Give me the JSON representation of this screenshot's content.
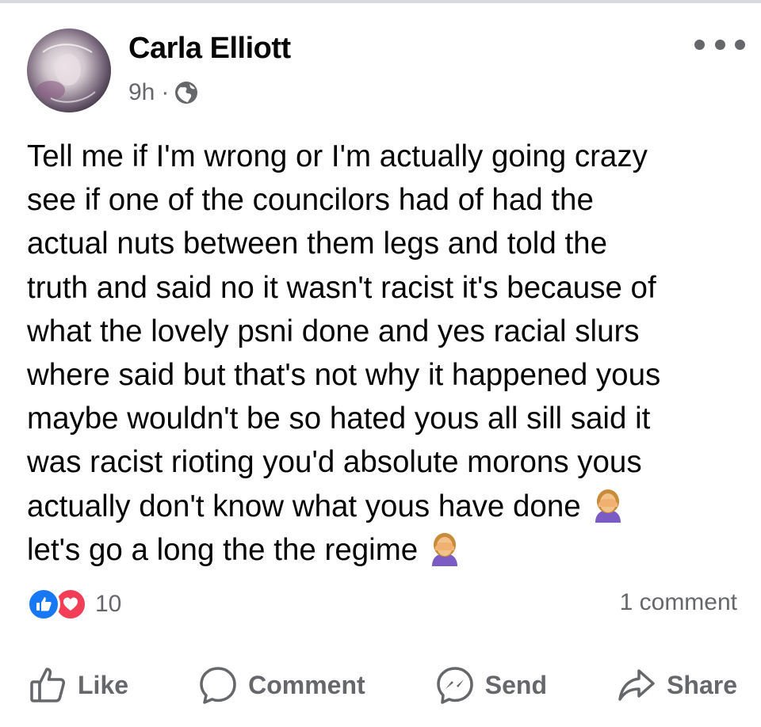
{
  "post": {
    "author": "Carla Elliott",
    "time": "9h",
    "separator": "·",
    "audience_icon": "globe-icon",
    "more_icon": "more-horizontal-icon",
    "text_lines": [
      "Tell me if I'm wrong or I'm actually going crazy",
      "see if one of the councilors had of had the",
      "actual nuts between them legs and told the",
      "truth and said no it wasn't racist it's because of",
      "what the lovely psni done and yes racial slurs",
      "where said but that's not why it happened yous",
      "maybe wouldn't be so hated yous all sill said it",
      "was racist rioting you'd absolute morons yous",
      "actually don't know what yous have done",
      "let's go a long the the regime"
    ],
    "emoji": "woman-facepalming-emoji"
  },
  "stats": {
    "reaction_icons": [
      "like-reaction-icon",
      "love-reaction-icon"
    ],
    "reaction_count": "10",
    "comment_count": "1 comment"
  },
  "actions": {
    "like": "Like",
    "comment": "Comment",
    "send": "Send",
    "share": "Share"
  },
  "colors": {
    "text": "#050505",
    "secondary": "#65676b",
    "like_blue": "#1877f2",
    "love_red": "#f33e58"
  }
}
